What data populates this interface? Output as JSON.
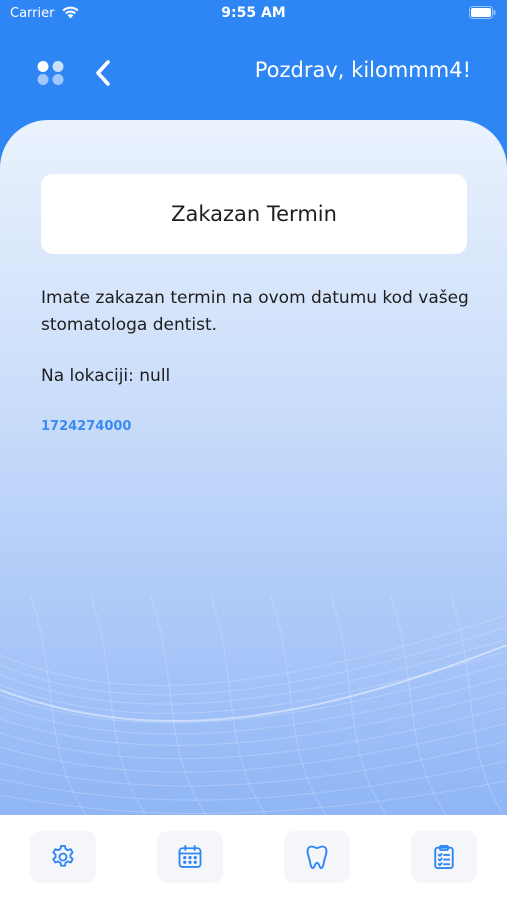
{
  "status_bar": {
    "carrier": "Carrier",
    "time": "9:55 AM"
  },
  "header": {
    "greeting": "Pozdrav, kilommm4!",
    "icons": [
      "menu-icon",
      "chevron-left-icon"
    ]
  },
  "appointment": {
    "title": "Zakazan Termin",
    "message": "Imate zakazan termin na ovom datumu kod vašeg stomatologa dentist.",
    "location": "Na lokaciji: null",
    "timestamp": "1724274000"
  },
  "bottom_nav": {
    "items": [
      {
        "icon": "gear-icon"
      },
      {
        "icon": "calendar-icon"
      },
      {
        "icon": "tooth-icon"
      },
      {
        "icon": "clipboard-list-icon"
      }
    ]
  },
  "colors": {
    "primary": "#2d86f3",
    "accent_text": "#3a8bf0",
    "nav_tile": "#f4f6fa"
  }
}
